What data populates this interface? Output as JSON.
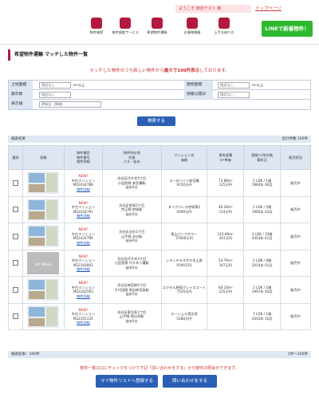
{
  "header": {
    "welcome": "ようこそ 田辺テスト 様",
    "top_link": "トップページ",
    "nav": [
      {
        "label": "物件検索",
        "icon": "search-icon"
      },
      {
        "label": "物件調査サービス",
        "icon": "house-search-icon"
      },
      {
        "label": "希望物件運輸",
        "icon": "mail-icon"
      },
      {
        "label": "お客様情報",
        "icon": "person-icon"
      },
      {
        "label": "上手な借り方",
        "icon": "tools-icon"
      }
    ],
    "line_button": "LINEで新着物件！"
  },
  "page_title": "希望物件運輸 マッチした物件一覧",
  "notice": {
    "pre": "マッチした物件のうち新しい物件から",
    "bold": "最大で100件表示",
    "post": "しております。"
  },
  "form": {
    "area_label": "土地面積",
    "area_min": "指定なし",
    "area_unit": "m²以上",
    "building_label": "建物面積",
    "building_min": "指定なし",
    "building_unit": "m²以上",
    "age_label": "築年数",
    "age_value": "指定なし",
    "info_label": "情報公開日",
    "info_value": "指定なし",
    "order_label": "表示順",
    "order_value": "更新日（降順）",
    "search_button": "検索する"
  },
  "results": {
    "header_left": "検索結果",
    "header_right": "合計件数 100件",
    "columns": [
      "選択",
      "画像",
      "物件種目\n物件番号\n物件詳細",
      "物件所在地\n交通\nバス・徒歩",
      "マンション名\n価格",
      "専有面積\nm²単価",
      "間取り/所在階\n築年月",
      "販売状況"
    ],
    "rows": [
      {
        "new": "NEW!",
        "type": "中古マンション",
        "no": "M22434788",
        "detail": "物件詳細",
        "addr": "渋谷区代々木5丁目",
        "line": "小田急線 参宮橋駅",
        "walk": "徒歩5分",
        "name": "ユーロハイツ参宮橋",
        "price": "9150万円",
        "area": "72.88m²",
        "unit": "125万円",
        "plan": "2 LDK / 1階",
        "built": "1984年 06月",
        "status": "販売中",
        "img": "photo"
      },
      {
        "new": "NEW!",
        "type": "中古マンション",
        "no": "M22434791",
        "detail": "物件詳細",
        "addr": "渋谷区笹塚2丁目",
        "line": "京王線 笹塚駅",
        "walk": "徒歩5分",
        "name": "ダイアパレス笹塚第2",
        "price": "4599万円",
        "area": "40.26m²",
        "unit": "114万円",
        "plan": "1 LDK / 2階",
        "built": "1985年 03月",
        "status": "販売中",
        "img": "photo"
      },
      {
        "new": "NEW!",
        "type": "中古マンション",
        "no": "M22434796",
        "detail": "物件詳細",
        "addr": "渋谷区渋谷1丁目",
        "line": "山手線 渋谷駅",
        "walk": "徒歩9分",
        "name": "青山パークタワー",
        "price": "37800万円",
        "area": "110.89m²",
        "unit": "341万円",
        "plan": "3 LDK / 23階",
        "built": "2003年 01月",
        "status": "販売中",
        "img": "photo"
      },
      {
        "new": "NEW!",
        "type": "中古マンション",
        "no": "M22341801",
        "detail": "物件詳細",
        "addr": "渋谷区代々木3丁目",
        "line": "小田急線 代々木八幡駅",
        "walk": "徒歩5分",
        "name": "シティテラス代々木上原",
        "price": "9190万円",
        "area": "54.76m²",
        "unit": "167万円",
        "plan": "2 LDK / 8階",
        "built": "2014年 01月",
        "status": "販売中",
        "img": "none"
      },
      {
        "new": "NEW!",
        "type": "中古マンション",
        "no": "M22342563",
        "detail": "物件詳細",
        "addr": "渋谷区神宮前6丁目",
        "line": "千代田線 明治神宮前駅",
        "walk": "徒歩5分",
        "name": "ユクセル原宿グレイスコート",
        "price": "7520万円",
        "area": "60.14m²",
        "unit": "125万円",
        "plan": "2 LDK / 1階",
        "built": "1997年 04月",
        "status": "販売中",
        "img": "photo"
      },
      {
        "new": "NEW!",
        "type": "中古マンション",
        "no": "M22355135",
        "detail": "物件詳細",
        "addr": "渋谷区恵比寿1丁目",
        "line": "山手線 恵比寿駅",
        "walk": "徒歩5分",
        "name": "セーシェル恵比寿",
        "price": "5280万円",
        "area": "",
        "unit": "",
        "plan": "1 LDK / 1階",
        "built": "2003年 10月",
        "status": "販売中",
        "img": "photo"
      }
    ],
    "footer_left": "検索結果：100件",
    "footer_right": "1件～100件"
  },
  "bottom_note": "物件一覧の口にチェックをつけて下記「問い合わせをする」から物件の照会ができます。",
  "buttons": {
    "add_list": "マイ物件リストへ登録する",
    "inquire": "問い合わせをする"
  },
  "colors": {
    "accent": "#b3193e",
    "primary_blue": "#2a5fb5",
    "line_green": "#2eb82e",
    "alert_red": "#c33"
  }
}
